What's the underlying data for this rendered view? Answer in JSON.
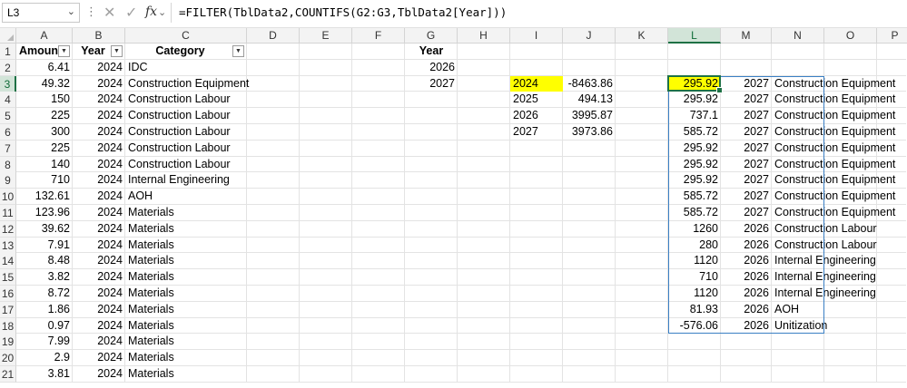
{
  "formula_bar": {
    "name_box": "L3",
    "name_box_dropdown": "chevron-down",
    "separator": "⋮",
    "cancel_icon": "✕",
    "enter_icon": "✓",
    "fx_label": "fx",
    "formula": "=FILTER(TblData2,COUNTIFS(G2:G3,TblData2[Year]))"
  },
  "columns": [
    "A",
    "B",
    "C",
    "D",
    "E",
    "F",
    "G",
    "H",
    "I",
    "J",
    "K",
    "L",
    "M",
    "N",
    "O",
    "P"
  ],
  "selected_column": "L",
  "selected_row": "3",
  "rows": [
    "1",
    "2",
    "3",
    "4",
    "5",
    "6",
    "7",
    "8",
    "9",
    "10",
    "11",
    "12",
    "13",
    "14",
    "15",
    "16",
    "17",
    "18",
    "19",
    "20",
    "21"
  ],
  "table": {
    "headers": [
      "Amount",
      "Year",
      "Category"
    ],
    "rows": [
      [
        "6.41",
        "2024",
        "IDC"
      ],
      [
        "49.32",
        "2024",
        "Construction Equipment"
      ],
      [
        "150",
        "2024",
        "Construction Labour"
      ],
      [
        "225",
        "2024",
        "Construction Labour"
      ],
      [
        "300",
        "2024",
        "Construction Labour"
      ],
      [
        "225",
        "2024",
        "Construction Labour"
      ],
      [
        "140",
        "2024",
        "Construction Labour"
      ],
      [
        "710",
        "2024",
        "Internal Engineering"
      ],
      [
        "132.61",
        "2024",
        "AOH"
      ],
      [
        "123.96",
        "2024",
        "Materials"
      ],
      [
        "39.62",
        "2024",
        "Materials"
      ],
      [
        "7.91",
        "2024",
        "Materials"
      ],
      [
        "8.48",
        "2024",
        "Materials"
      ],
      [
        "3.82",
        "2024",
        "Materials"
      ],
      [
        "8.72",
        "2024",
        "Materials"
      ],
      [
        "1.86",
        "2024",
        "Materials"
      ],
      [
        "0.97",
        "2024",
        "Materials"
      ],
      [
        "7.99",
        "2024",
        "Materials"
      ],
      [
        "2.9",
        "2024",
        "Materials"
      ],
      [
        "3.81",
        "2024",
        "Materials"
      ]
    ]
  },
  "criteria": {
    "header": "Year",
    "values": [
      "2026",
      "2027"
    ]
  },
  "summary": [
    [
      "2024",
      "-8463.86"
    ],
    [
      "2025",
      "494.13"
    ],
    [
      "2026",
      "3995.87"
    ],
    [
      "2027",
      "3973.86"
    ]
  ],
  "spill": [
    [
      "295.92",
      "2027",
      "Construction Equipment"
    ],
    [
      "295.92",
      "2027",
      "Construction Equipment"
    ],
    [
      "737.1",
      "2027",
      "Construction Equipment"
    ],
    [
      "585.72",
      "2027",
      "Construction Equipment"
    ],
    [
      "295.92",
      "2027",
      "Construction Equipment"
    ],
    [
      "295.92",
      "2027",
      "Construction Equipment"
    ],
    [
      "295.92",
      "2027",
      "Construction Equipment"
    ],
    [
      "585.72",
      "2027",
      "Construction Equipment"
    ],
    [
      "585.72",
      "2027",
      "Construction Equipment"
    ],
    [
      "1260",
      "2026",
      "Construction Labour"
    ],
    [
      "280",
      "2026",
      "Construction Labour"
    ],
    [
      "1120",
      "2026",
      "Internal Engineering"
    ],
    [
      "710",
      "2026",
      "Internal Engineering"
    ],
    [
      "1120",
      "2026",
      "Internal Engineering"
    ],
    [
      "81.93",
      "2026",
      "AOH"
    ],
    [
      "-576.06",
      "2026",
      "Unitization"
    ]
  ],
  "colors": {
    "highlight": "#ffff00",
    "selection": "#1e7145",
    "spill_border": "#3a7fc4"
  }
}
